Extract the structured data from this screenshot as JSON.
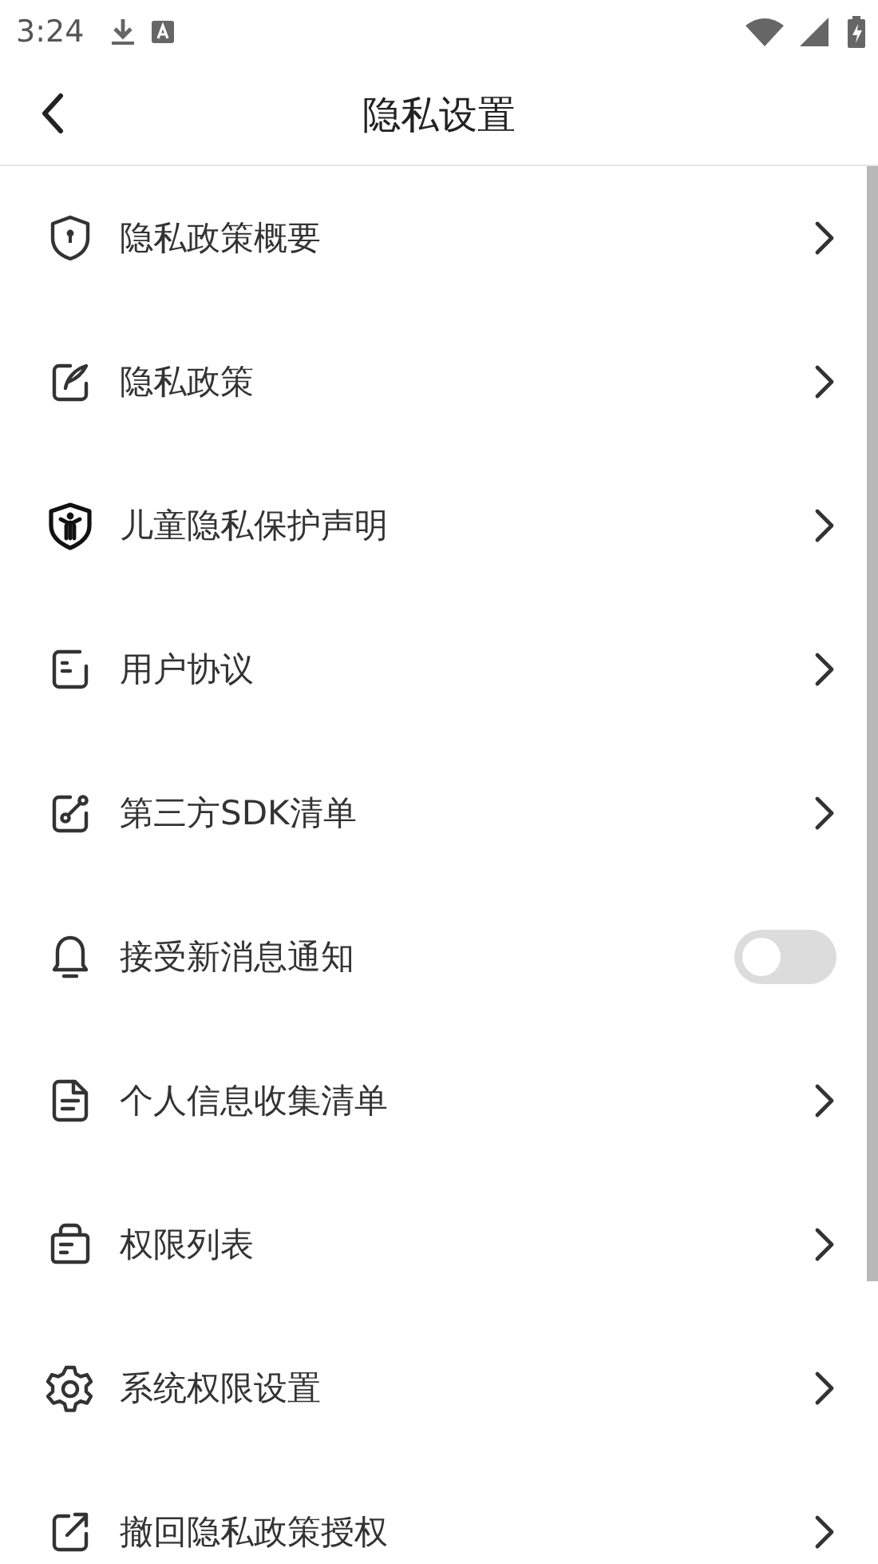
{
  "status_bar": {
    "time": "3:24"
  },
  "header": {
    "title": "隐私设置"
  },
  "items": [
    {
      "label": "隐私政策概要",
      "kind": "link"
    },
    {
      "label": "隐私政策",
      "kind": "link"
    },
    {
      "label": "儿童隐私保护声明",
      "kind": "link"
    },
    {
      "label": "用户协议",
      "kind": "link"
    },
    {
      "label": "第三方SDK清单",
      "kind": "link"
    },
    {
      "label": "接受新消息通知",
      "kind": "toggle",
      "on": false
    },
    {
      "label": "个人信息收集清单",
      "kind": "link"
    },
    {
      "label": "权限列表",
      "kind": "link"
    },
    {
      "label": "系统权限设置",
      "kind": "link"
    },
    {
      "label": "撤回隐私政策授权",
      "kind": "link"
    }
  ]
}
